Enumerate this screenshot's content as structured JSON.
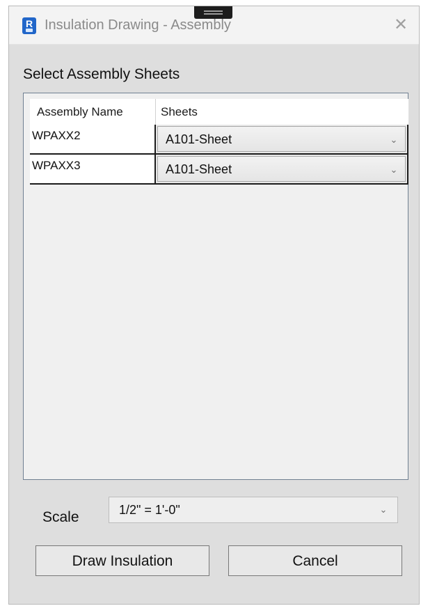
{
  "window": {
    "title": "Insulation Drawing - Assembly",
    "app_icon_letter": "R",
    "close_label": "✕"
  },
  "assembly_section": {
    "label": "Select Assembly Sheets",
    "columns": [
      "Assembly Name",
      "Sheets"
    ],
    "rows": [
      {
        "assembly_name": "WPAXX2",
        "sheet": "A101-Sheet"
      },
      {
        "assembly_name": "WPAXX3",
        "sheet": "A101-Sheet"
      }
    ]
  },
  "scale": {
    "label": "Scale",
    "value": "1/2\" = 1'-0\""
  },
  "buttons": {
    "draw": "Draw Insulation",
    "cancel": "Cancel"
  },
  "icons": {
    "app": "revit-app-icon",
    "close": "close-icon",
    "dropdown": "chevron-down-icon"
  }
}
